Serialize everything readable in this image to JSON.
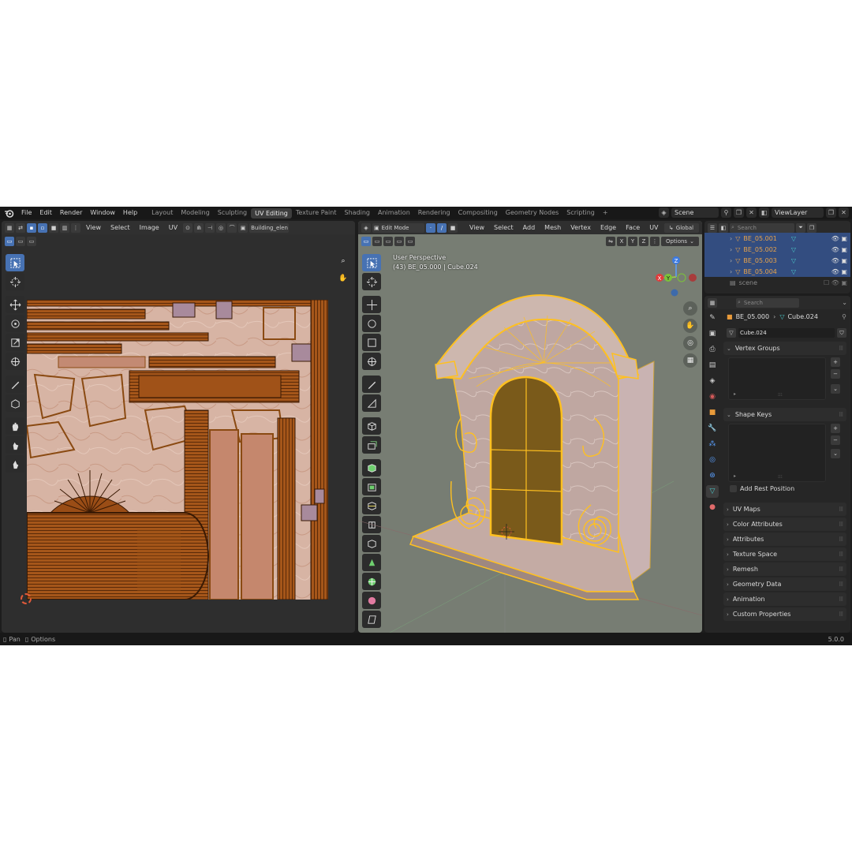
{
  "menus": [
    "File",
    "Edit",
    "Render",
    "Window",
    "Help"
  ],
  "workspace_tabs": [
    "Layout",
    "Modeling",
    "Sculpting",
    "UV Editing",
    "Texture Paint",
    "Shading",
    "Animation",
    "Rendering",
    "Compositing",
    "Geometry Nodes",
    "Scripting"
  ],
  "active_workspace": "UV Editing",
  "scene_name": "Scene",
  "view_layer": "ViewLayer",
  "uv_editor": {
    "menus": [
      "View",
      "Select",
      "Image",
      "UV"
    ],
    "image_name": "Building_elen"
  },
  "viewport": {
    "mode": "Edit Mode",
    "menus": [
      "View",
      "Select",
      "Add",
      "Mesh",
      "Vertex",
      "Edge",
      "Face",
      "UV"
    ],
    "orientation": "Global",
    "axes": [
      "X",
      "Y",
      "Z"
    ],
    "options_label": "Options",
    "perspective_label": "User Perspective",
    "object_info": "(43) BE_05.000 | Cube.024",
    "gizmo_axes": [
      "Z",
      "X",
      "Y"
    ]
  },
  "outliner": {
    "search_placeholder": "Search",
    "items": [
      "BE_05.001",
      "BE_05.002",
      "BE_05.003",
      "BE_05.004"
    ],
    "collection": "scene"
  },
  "properties": {
    "search_placeholder": "Search",
    "breadcrumb_object": "BE_05.000",
    "breadcrumb_mesh": "Cube.024",
    "mesh_name": "Cube.024",
    "vertex_groups": "Vertex Groups",
    "shape_keys": "Shape Keys",
    "add_rest_position": "Add Rest Position",
    "panels": [
      "UV Maps",
      "Color Attributes",
      "Attributes",
      "Texture Space",
      "Remesh",
      "Geometry Data",
      "Animation",
      "Custom Properties"
    ]
  },
  "status": {
    "pan": "Pan",
    "options": "Options",
    "version": "5.0.0"
  },
  "colors": {
    "accent": "#4772b3",
    "selection": "#ffb300",
    "uv_orange": "#b5631f",
    "viewport_bg": "#777d73"
  }
}
